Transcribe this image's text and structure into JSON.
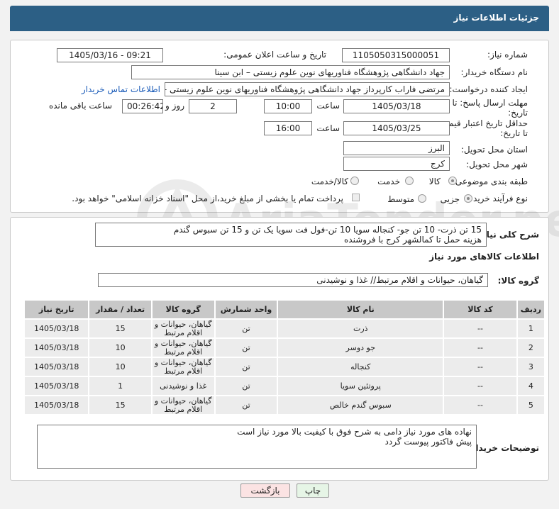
{
  "header": {
    "title": "جزئیات اطلاعات نیاز"
  },
  "fields": {
    "need_number_label": "شماره نیاز:",
    "need_number": "1105050315000051",
    "announce_label": "تاریخ و ساعت اعلان عمومی:",
    "announce_value": "1405/03/16 - 09:21",
    "buyer_label": "نام دستگاه خریدار:",
    "buyer_value": "جهاد دانشگاهی پژوهشگاه فناوریهای نوین علوم زیستی – ابن سینا",
    "creator_label": "ایجاد کننده درخواست:",
    "creator_value": "مرتضی فاراب کارپرداز جهاد دانشگاهی پژوهشگاه فناوریهای نوین علوم زیستی –",
    "contact_link": "اطلاعات تماس خریدار",
    "deadline_label_1": "مهلت ارسال پاسخ: تا",
    "deadline_label_2": "تاریخ:",
    "deadline_date": "1405/03/18",
    "time_label": "ساعت",
    "deadline_time": "10:00",
    "days_value": "2",
    "days_label": "روز و",
    "remaining_time": "00:26:42",
    "remaining_label": "ساعت باقی مانده",
    "min_validity_label_1": "حداقل تاریخ اعتبار قیمت:",
    "min_validity_label_2": "تا تاریخ:",
    "validity_date": "1405/03/25",
    "validity_time": "16:00",
    "province_label": "استان محل تحویل:",
    "province_value": "البرز",
    "city_label": "شهر محل تحویل:",
    "city_value": "کرج",
    "category_label": "طبقه بندی موضوعی:",
    "category_options": [
      "کالا",
      "خدمت",
      "کالا/خدمت"
    ],
    "process_label": "نوع فرآیند خرید :",
    "process_options": [
      "جزیی",
      "متوسط"
    ],
    "payment_note": "پرداخت تمام یا بخشی از مبلغ خرید،از محل \"اسناد خزانه اسلامی\" خواهد بود."
  },
  "description": {
    "label": "شرح کلی نیاز:",
    "line1": "15 تن ذرت- 10 تن جو- کنجاله سویا 10 تن-فول فت سویا یک تن و 15 تن سبوس گندم",
    "line2": "هزینه حمل تا کمالشهر کرج با فروشنده"
  },
  "goods": {
    "section_title": "اطلاعات کالاهای مورد نیاز",
    "group_label": "گروه کالا:",
    "group_value": "گیاهان، حیوانات و اقلام مرتبط// غذا و نوشیدنی",
    "columns": [
      "ردیف",
      "کد کالا",
      "نام کالا",
      "واحد شمارش",
      "گروه کالا",
      "تعداد / مقدار",
      "تاریخ نیاز"
    ],
    "rows": [
      {
        "row": "1",
        "code": "--",
        "name": "ذرت",
        "unit": "تن",
        "group1": "گیاهان، حیوانات و",
        "group2": "اقلام مرتبط",
        "qty": "15",
        "date": "1405/03/18"
      },
      {
        "row": "2",
        "code": "--",
        "name": "جو دوسر",
        "unit": "تن",
        "group1": "گیاهان، حیوانات و",
        "group2": "اقلام مرتبط",
        "qty": "10",
        "date": "1405/03/18"
      },
      {
        "row": "3",
        "code": "--",
        "name": "کنجاله",
        "unit": "تن",
        "group1": "گیاهان، حیوانات و",
        "group2": "اقلام مرتبط",
        "qty": "10",
        "date": "1405/03/18"
      },
      {
        "row": "4",
        "code": "--",
        "name": "پروتئین سویا",
        "unit": "تن",
        "group1": "غذا و نوشیدنی",
        "group2": "",
        "qty": "1",
        "date": "1405/03/18"
      },
      {
        "row": "5",
        "code": "--",
        "name": "سبوس گندم خالص",
        "unit": "تن",
        "group1": "گیاهان، حیوانات و",
        "group2": "اقلام مرتبط",
        "qty": "15",
        "date": "1405/03/18"
      }
    ]
  },
  "buyer_notes": {
    "label": "توضیحات خریدار:",
    "line1": "نهاده های مورد نیاز دامی به شرح فوق با کیفیت بالا مورد نیاز است",
    "line2": "پیش فاکتور پیوست گردد"
  },
  "buttons": {
    "print": "چاپ",
    "back": "بازگشت"
  },
  "watermark": "AriaTender.net",
  "colors": {
    "header": "#2c5f85",
    "print_bg": "#e6f5e6",
    "back_bg": "#fbe3e3",
    "link": "#1a5bb8"
  }
}
